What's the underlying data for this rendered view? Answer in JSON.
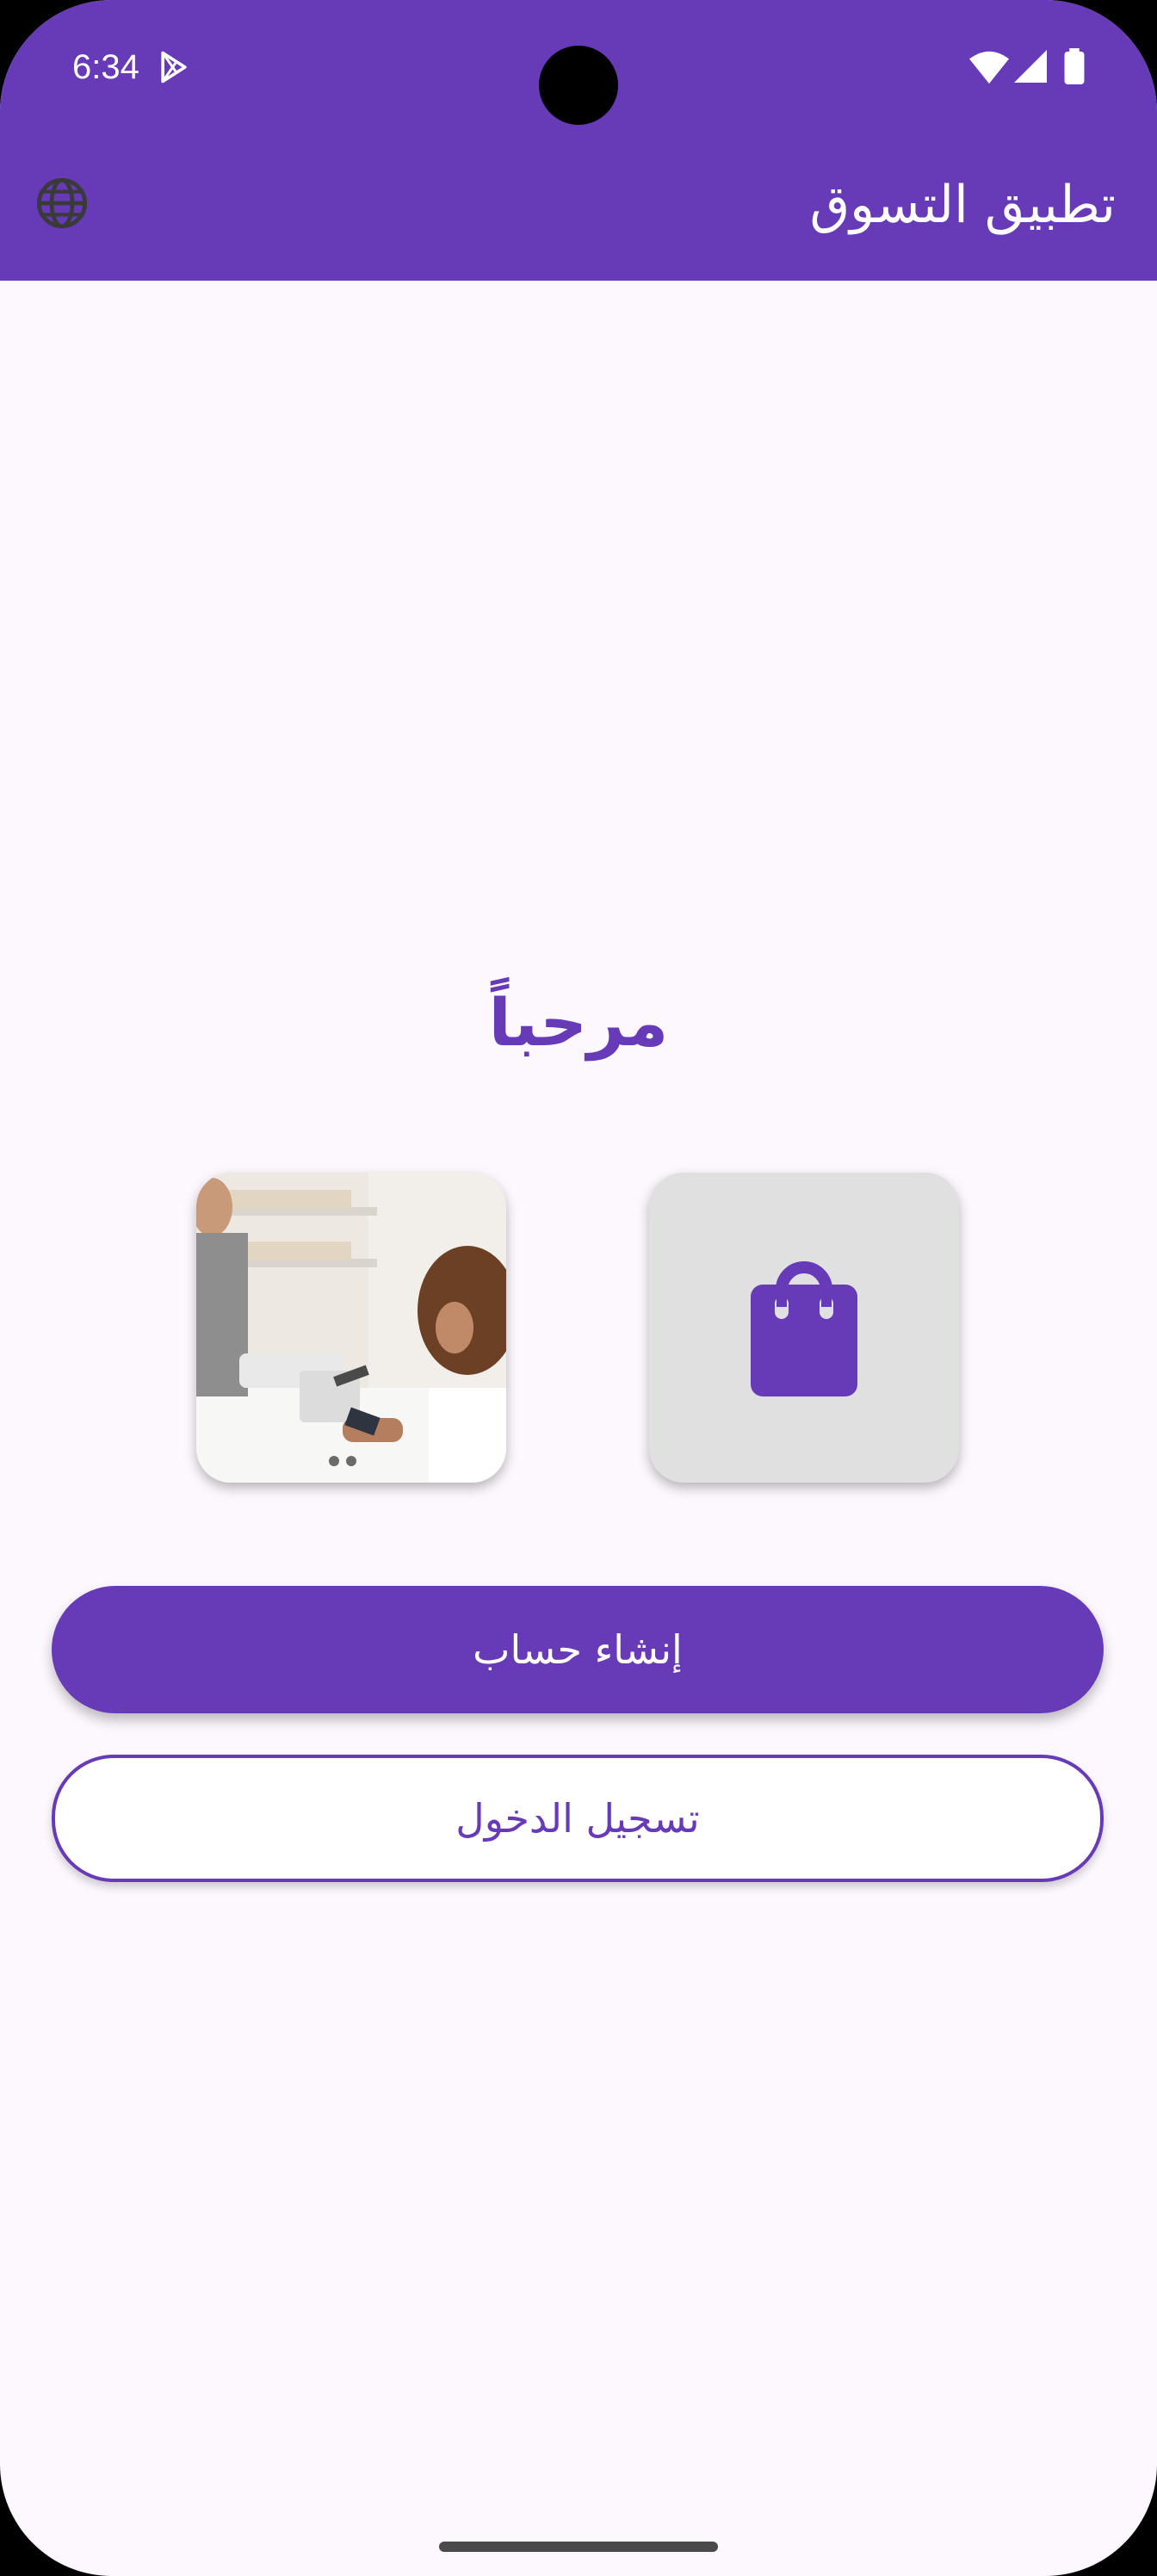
{
  "status_bar": {
    "time": "6:34",
    "icons": [
      "play-store-icon",
      "wifi-icon",
      "signal-icon",
      "battery-icon"
    ]
  },
  "app_bar": {
    "title": "تطبيق التسوق",
    "language_icon": "globe-icon"
  },
  "main": {
    "welcome_title": "مرحباً",
    "cards": [
      {
        "type": "photo",
        "depicts": "store-checkout-photo"
      },
      {
        "type": "icon",
        "icon": "shopping-bag-icon"
      }
    ],
    "create_account_label": "إنشاء حساب",
    "login_label": "تسجيل الدخول"
  },
  "colors": {
    "primary": "#673AB7",
    "background": "#FDF7FE",
    "card_gray": "#E0E0E0",
    "on_primary": "#FFFFFF"
  }
}
